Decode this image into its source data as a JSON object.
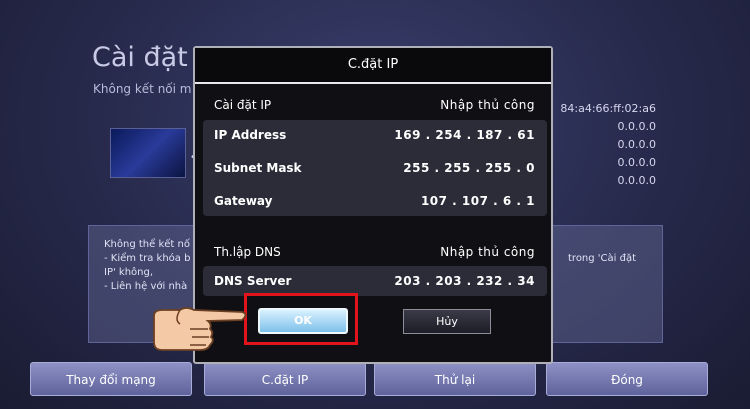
{
  "background": {
    "title": "Cài đặt m",
    "subtitle": "Không kết nối m",
    "thumb_mark": "•",
    "right_values": [
      "84:a4:66:ff:02:a6",
      "0.0.0.0",
      "0.0.0.0",
      "0.0.0.0",
      "0.0.0.0"
    ],
    "info_left": [
      "Không thể kết nố",
      "- Kiểm tra khóa b",
      "IP' không,",
      "- Liên hệ với nhà"
    ],
    "info_right": [
      "trong 'Cài đặt"
    ],
    "bottom_buttons": [
      "Thay đổi mạng",
      "C.đặt IP",
      "Thử lại",
      "Đóng"
    ]
  },
  "dialog": {
    "title": "C.đặt IP",
    "ip_setting": {
      "label": "Cài đặt IP",
      "value": "Nhập thủ công"
    },
    "ip_address": {
      "label": "IP Address",
      "value": "169 . 254 . 187 . 61"
    },
    "subnet_mask": {
      "label": "Subnet Mask",
      "value": "255 . 255 . 255 . 0"
    },
    "gateway": {
      "label": "Gateway",
      "value": "107 . 107 . 6 . 1"
    },
    "dns_setting": {
      "label": "Th.lập DNS",
      "value": "Nhập thủ công"
    },
    "dns_server": {
      "label": "DNS Server",
      "value": "203 . 203 . 232 . 34"
    },
    "ok_label": "OK",
    "cancel_label": "Hủy"
  },
  "colors": {
    "highlight_frame": "#e0141a",
    "ok_button": "#7ec1ea",
    "background": "#26294a"
  },
  "icons": {
    "pointer": "pointing-hand-icon"
  }
}
